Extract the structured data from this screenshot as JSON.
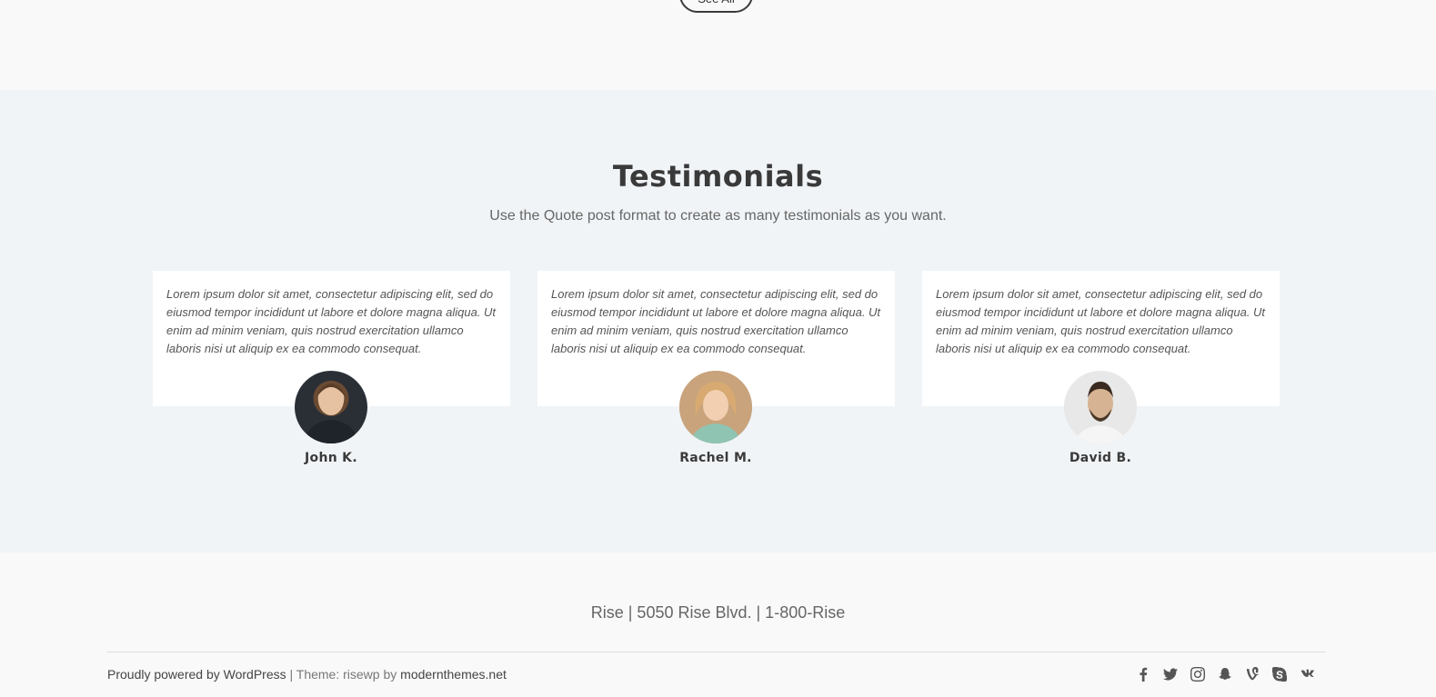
{
  "top": {
    "see_all_label": "See All"
  },
  "testimonials": {
    "title": "Testimonials",
    "subtitle": "Use the Quote post format to create as many testimonials as you want.",
    "items": [
      {
        "quote": "Lorem ipsum dolor sit amet, consectetur adipiscing elit, sed do eiusmod tempor incididunt ut labore et dolore magna aliqua. Ut enim ad minim veniam, quis nostrud exercitation ullamco laboris nisi ut aliquip ex ea commodo consequat.",
        "name": "John K."
      },
      {
        "quote": "Lorem ipsum dolor sit amet, consectetur adipiscing elit, sed do eiusmod tempor incididunt ut labore et dolore magna aliqua. Ut enim ad minim veniam, quis nostrud exercitation ullamco laboris nisi ut aliquip ex ea commodo consequat.",
        "name": "Rachel M."
      },
      {
        "quote": "Lorem ipsum dolor sit amet, consectetur adipiscing elit, sed do eiusmod tempor incididunt ut labore et dolore magna aliqua. Ut enim ad minim veniam, quis nostrud exercitation ullamco laboris nisi ut aliquip ex ea commodo consequat.",
        "name": "David B."
      }
    ]
  },
  "footer": {
    "contact": "Rise | 5050 Rise Blvd. | 1-800-Rise",
    "powered_link": "Proudly powered by WordPress",
    "theme_text": " | Theme: risewp by ",
    "theme_link": "modernthemes.net",
    "social": [
      "facebook-icon",
      "twitter-icon",
      "instagram-icon",
      "snapchat-icon",
      "vine-icon",
      "skype-icon",
      "vk-icon"
    ]
  },
  "colors": {
    "page_bg": "#f9f9f9",
    "section_bg": "#f1f4f7",
    "card_bg": "#ffffff",
    "heading": "#3a3a3a"
  }
}
